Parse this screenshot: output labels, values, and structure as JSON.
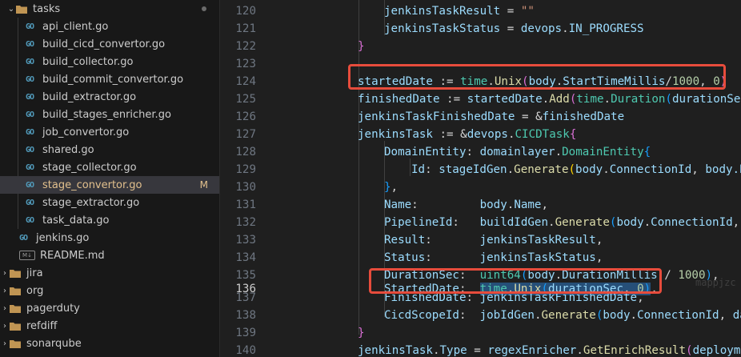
{
  "explorer": {
    "tasks_folder": {
      "label": "tasks"
    },
    "tasks_files": [
      {
        "label": "api_client.go"
      },
      {
        "label": "build_cicd_convertor.go"
      },
      {
        "label": "build_collector.go"
      },
      {
        "label": "build_commit_convertor.go"
      },
      {
        "label": "build_extractor.go"
      },
      {
        "label": "build_stages_enricher.go"
      },
      {
        "label": "job_convertor.go"
      },
      {
        "label": "shared.go"
      },
      {
        "label": "stage_collector.go"
      },
      {
        "label": "stage_convertor.go",
        "badge": "M"
      },
      {
        "label": "stage_extractor.go"
      },
      {
        "label": "task_data.go"
      }
    ],
    "root_files": [
      {
        "label": "jenkins.go"
      },
      {
        "label": "README.md"
      }
    ],
    "folders": [
      {
        "label": "jira"
      },
      {
        "label": "org"
      },
      {
        "label": "pagerduty"
      },
      {
        "label": "refdiff"
      },
      {
        "label": "sonarqube"
      }
    ]
  },
  "editor": {
    "line_numbers": [
      "120",
      "121",
      "122",
      "123",
      "124",
      "125",
      "126",
      "127",
      "128",
      "129",
      "130",
      "131",
      "132",
      "133",
      "134",
      "135",
      "136",
      "137",
      "138",
      "139",
      "140"
    ],
    "active_line": "136",
    "tokens": {
      "l120_a": "jenkinsTaskResult",
      "l120_b": " = ",
      "l120_c": "\"\"",
      "l121_a": "jenkinsTaskStatus",
      "l121_b": " = ",
      "l121_c": "devops",
      "l121_d": ".",
      "l121_e": "IN_PROGRESS",
      "l122_a": "}",
      "l124_a": "startedDate",
      "l124_b": " := ",
      "l124_c": "time",
      "l124_d": ".",
      "l124_e": "Unix",
      "l124_f": "(",
      "l124_g": "body",
      "l124_h": ".",
      "l124_i": "StartTimeMillis",
      "l124_j": "/",
      "l124_k": "1000",
      "l124_l": ", ",
      "l124_m": "0",
      "l124_n": ")",
      "l125_a": "finishedDate",
      "l125_b": " := ",
      "l125_c": "startedDate",
      "l125_d": ".",
      "l125_e": "Add",
      "l125_f": "(",
      "l125_g": "time",
      "l125_h": ".",
      "l125_i": "Duration",
      "l125_j": "(",
      "l125_k": "durationSec",
      "l126_a": "jenkinsTaskFinishedDate",
      "l126_b": " = &",
      "l126_c": "finishedDate",
      "l127_a": "jenkinsTask",
      "l127_b": " := &",
      "l127_c": "devops",
      "l127_d": ".",
      "l127_e": "CICDTask",
      "l127_f": "{",
      "l128_a": "DomainEntity",
      "l128_b": ": ",
      "l128_c": "domainlayer",
      "l128_d": ".",
      "l128_e": "DomainEntity",
      "l128_f": "{",
      "l129_a": "Id",
      "l129_b": ": ",
      "l129_c": "stageIdGen",
      "l129_d": ".",
      "l129_e": "Generate",
      "l129_f": "(",
      "l129_g": "body",
      "l129_h": ".",
      "l129_i": "ConnectionId",
      "l129_j": ", ",
      "l129_k": "body",
      "l129_l": ".B",
      "l130_a": "}",
      "l130_b": ",",
      "l131_a": "Name",
      "l131_b": ":         ",
      "l131_c": "body",
      "l131_d": ".",
      "l131_e": "Name",
      "l131_f": ",",
      "l132_a": "PipelineId",
      "l132_b": ":   ",
      "l132_c": "buildIdGen",
      "l132_d": ".",
      "l132_e": "Generate",
      "l132_f": "(",
      "l132_g": "body",
      "l132_h": ".",
      "l132_i": "ConnectionId",
      "l132_j": ",",
      "l133_a": "Result",
      "l133_b": ":       ",
      "l133_c": "jenkinsTaskResult",
      "l133_d": ",",
      "l134_a": "Status",
      "l134_b": ":       ",
      "l134_c": "jenkinsTaskStatus",
      "l134_d": ",",
      "l135_a": "DurationSec",
      "l135_b": ":  ",
      "l135_c": "uint64",
      "l135_d": "(",
      "l135_e": "body",
      "l135_f": ".",
      "l135_g": "DurationMillis",
      "l135_h": " / ",
      "l135_i": "1000",
      "l135_j": ")",
      "l135_k": ",",
      "l136_a": "StartedDate",
      "l136_b": ":  ",
      "l136_c": "time",
      "l136_d": ".",
      "l136_e": "Unix",
      "l136_f": "(",
      "l136_g": "durationSec",
      "l136_h": ", ",
      "l136_i": "0",
      "l136_j": ")",
      "l136_k": ",",
      "l137_a": "FinishedDate",
      "l137_b": ": ",
      "l137_c": "jenkinsTaskFinishedDate",
      "l137_d": ",",
      "l138_a": "CicdScopeId",
      "l138_b": ":  ",
      "l138_c": "jobIdGen",
      "l138_d": ".",
      "l138_e": "Generate",
      "l138_f": "(",
      "l138_g": "body",
      "l138_h": ".",
      "l138_i": "ConnectionId",
      "l138_j": ", ",
      "l138_k": "da",
      "l139_a": "}",
      "l140_a": "jenkinsTask",
      "l140_b": ".",
      "l140_c": "Type",
      "l140_d": " = ",
      "l140_e": "regexEnricher",
      "l140_f": ".",
      "l140_g": "GetEnrichResult",
      "l140_h": "(",
      "l140_i": "deployme"
    },
    "watermark": "mappjzc"
  },
  "colors": {
    "highlight_box": "#e74c3c",
    "selection": "#264f78",
    "modified_badge": "#e2c08d",
    "go_icon": "#519aba"
  }
}
